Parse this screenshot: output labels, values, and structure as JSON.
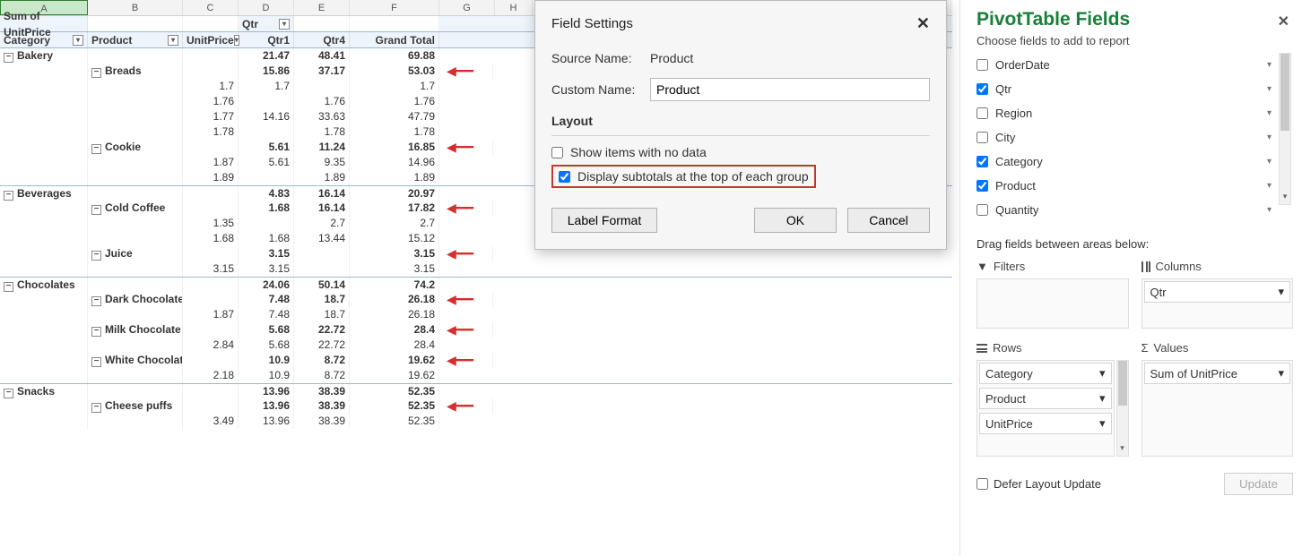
{
  "col_letters": [
    "A",
    "B",
    "C",
    "D",
    "E",
    "F",
    "G",
    "H"
  ],
  "pivot": {
    "sum_label": "Sum of UnitPrice",
    "qtr_label": "Qtr",
    "head_category": "Category",
    "head_product": "Product",
    "head_unitprice": "UnitPrice",
    "head_qtr1": "Qtr1",
    "head_qtr4": "Qtr4",
    "head_grand": "Grand Total",
    "groups": [
      {
        "name": "Bakery",
        "qtr1": "21.47",
        "qtr4": "48.41",
        "grand": "69.88",
        "products": [
          {
            "name": "Breads",
            "qtr1": "15.86",
            "qtr4": "37.17",
            "grand": "53.03",
            "arrow": true,
            "rows": [
              {
                "up": "1.7",
                "qtr1": "1.7",
                "qtr4": "",
                "grand": "1.7"
              },
              {
                "up": "1.76",
                "qtr1": "",
                "qtr4": "1.76",
                "grand": "1.76"
              },
              {
                "up": "1.77",
                "qtr1": "14.16",
                "qtr4": "33.63",
                "grand": "47.79"
              },
              {
                "up": "1.78",
                "qtr1": "",
                "qtr4": "1.78",
                "grand": "1.78"
              }
            ]
          },
          {
            "name": "Cookie",
            "qtr1": "5.61",
            "qtr4": "11.24",
            "grand": "16.85",
            "arrow": true,
            "rows": [
              {
                "up": "1.87",
                "qtr1": "5.61",
                "qtr4": "9.35",
                "grand": "14.96"
              },
              {
                "up": "1.89",
                "qtr1": "",
                "qtr4": "1.89",
                "grand": "1.89"
              }
            ]
          }
        ]
      },
      {
        "name": "Beverages",
        "qtr1": "4.83",
        "qtr4": "16.14",
        "grand": "20.97",
        "products": [
          {
            "name": "Cold Coffee",
            "qtr1": "1.68",
            "qtr4": "16.14",
            "grand": "17.82",
            "arrow": true,
            "rows": [
              {
                "up": "1.35",
                "qtr1": "",
                "qtr4": "2.7",
                "grand": "2.7"
              },
              {
                "up": "1.68",
                "qtr1": "1.68",
                "qtr4": "13.44",
                "grand": "15.12"
              }
            ]
          },
          {
            "name": "Juice",
            "qtr1": "3.15",
            "qtr4": "",
            "grand": "3.15",
            "arrow": true,
            "rows": [
              {
                "up": "3.15",
                "qtr1": "3.15",
                "qtr4": "",
                "grand": "3.15"
              }
            ]
          }
        ]
      },
      {
        "name": "Chocolates",
        "qtr1": "24.06",
        "qtr4": "50.14",
        "grand": "74.2",
        "products": [
          {
            "name": "Dark Chocolate",
            "qtr1": "7.48",
            "qtr4": "18.7",
            "grand": "26.18",
            "arrow": true,
            "rows": [
              {
                "up": "1.87",
                "qtr1": "7.48",
                "qtr4": "18.7",
                "grand": "26.18"
              }
            ]
          },
          {
            "name": "Milk Chocolate",
            "qtr1": "5.68",
            "qtr4": "22.72",
            "grand": "28.4",
            "arrow": true,
            "rows": [
              {
                "up": "2.84",
                "qtr1": "5.68",
                "qtr4": "22.72",
                "grand": "28.4"
              }
            ]
          },
          {
            "name": "White Chocolate",
            "qtr1": "10.9",
            "qtr4": "8.72",
            "grand": "19.62",
            "arrow": true,
            "rows": [
              {
                "up": "2.18",
                "qtr1": "10.9",
                "qtr4": "8.72",
                "grand": "19.62"
              }
            ]
          }
        ]
      },
      {
        "name": "Snacks",
        "qtr1": "13.96",
        "qtr4": "38.39",
        "grand": "52.35",
        "products": [
          {
            "name": "Cheese puffs",
            "qtr1": "13.96",
            "qtr4": "38.39",
            "grand": "52.35",
            "arrow": true,
            "rows": [
              {
                "up": "3.49",
                "qtr1": "13.96",
                "qtr4": "38.39",
                "grand": "52.35"
              }
            ]
          }
        ]
      }
    ]
  },
  "dialog": {
    "title": "Field Settings",
    "source_label": "Source Name:",
    "source_value": "Product",
    "custom_label": "Custom Name:",
    "custom_value": "Product",
    "layout_label": "Layout",
    "show_items_label": "Show items with no data",
    "display_subtotals_label": "Display subtotals at the top of each group",
    "label_format_btn": "Label Format",
    "ok_btn": "OK",
    "cancel_btn": "Cancel"
  },
  "pane": {
    "title": "PivotTable Fields",
    "hint": "Choose fields to add to report",
    "fields": [
      {
        "label": "OrderDate",
        "checked": false
      },
      {
        "label": "Qtr",
        "checked": true
      },
      {
        "label": "Region",
        "checked": false
      },
      {
        "label": "City",
        "checked": false
      },
      {
        "label": "Category",
        "checked": true
      },
      {
        "label": "Product",
        "checked": true
      },
      {
        "label": "Quantity",
        "checked": false
      }
    ],
    "drag_hint": "Drag fields between areas below:",
    "area_filters": "Filters",
    "area_columns": "Columns",
    "area_rows": "Rows",
    "area_values": "Values",
    "col_chips": [
      "Qtr"
    ],
    "row_chips": [
      "Category",
      "Product",
      "UnitPrice"
    ],
    "val_chips": [
      "Sum of UnitPrice"
    ],
    "defer_label": "Defer Layout Update",
    "update_btn": "Update"
  }
}
